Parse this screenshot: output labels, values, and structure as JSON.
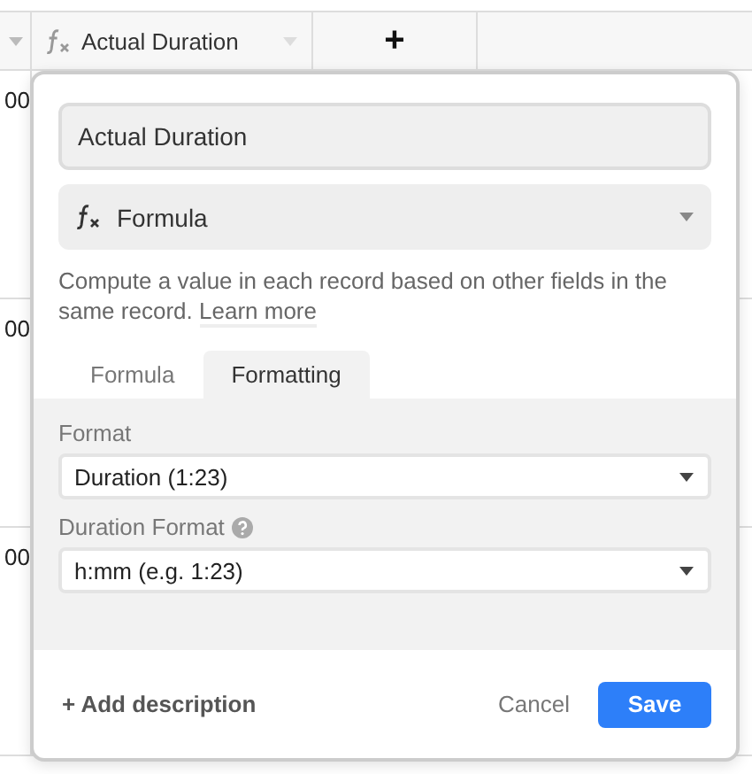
{
  "grid": {
    "header": {
      "field": {
        "label": "Actual Duration"
      },
      "add_button": "+"
    },
    "rows": [
      {
        "cell": "00"
      },
      {
        "cell": "00"
      },
      {
        "cell": "00"
      }
    ]
  },
  "field_editor": {
    "name": "Actual Duration",
    "type": {
      "label": "Formula"
    },
    "description": "Compute a value in each record based on other fields in the same record.",
    "learn_more": "Learn more",
    "tabs": [
      {
        "label": "Formula",
        "selected": false
      },
      {
        "label": "Formatting",
        "selected": true
      }
    ],
    "settings": [
      {
        "label": "Format",
        "help": false,
        "value": "Duration (1:23)"
      },
      {
        "label": "Duration Format",
        "help": true,
        "value": "h:mm (e.g. 1:23)"
      }
    ],
    "add_description": "+ Add description",
    "cancel": "Cancel",
    "save": "Save"
  }
}
